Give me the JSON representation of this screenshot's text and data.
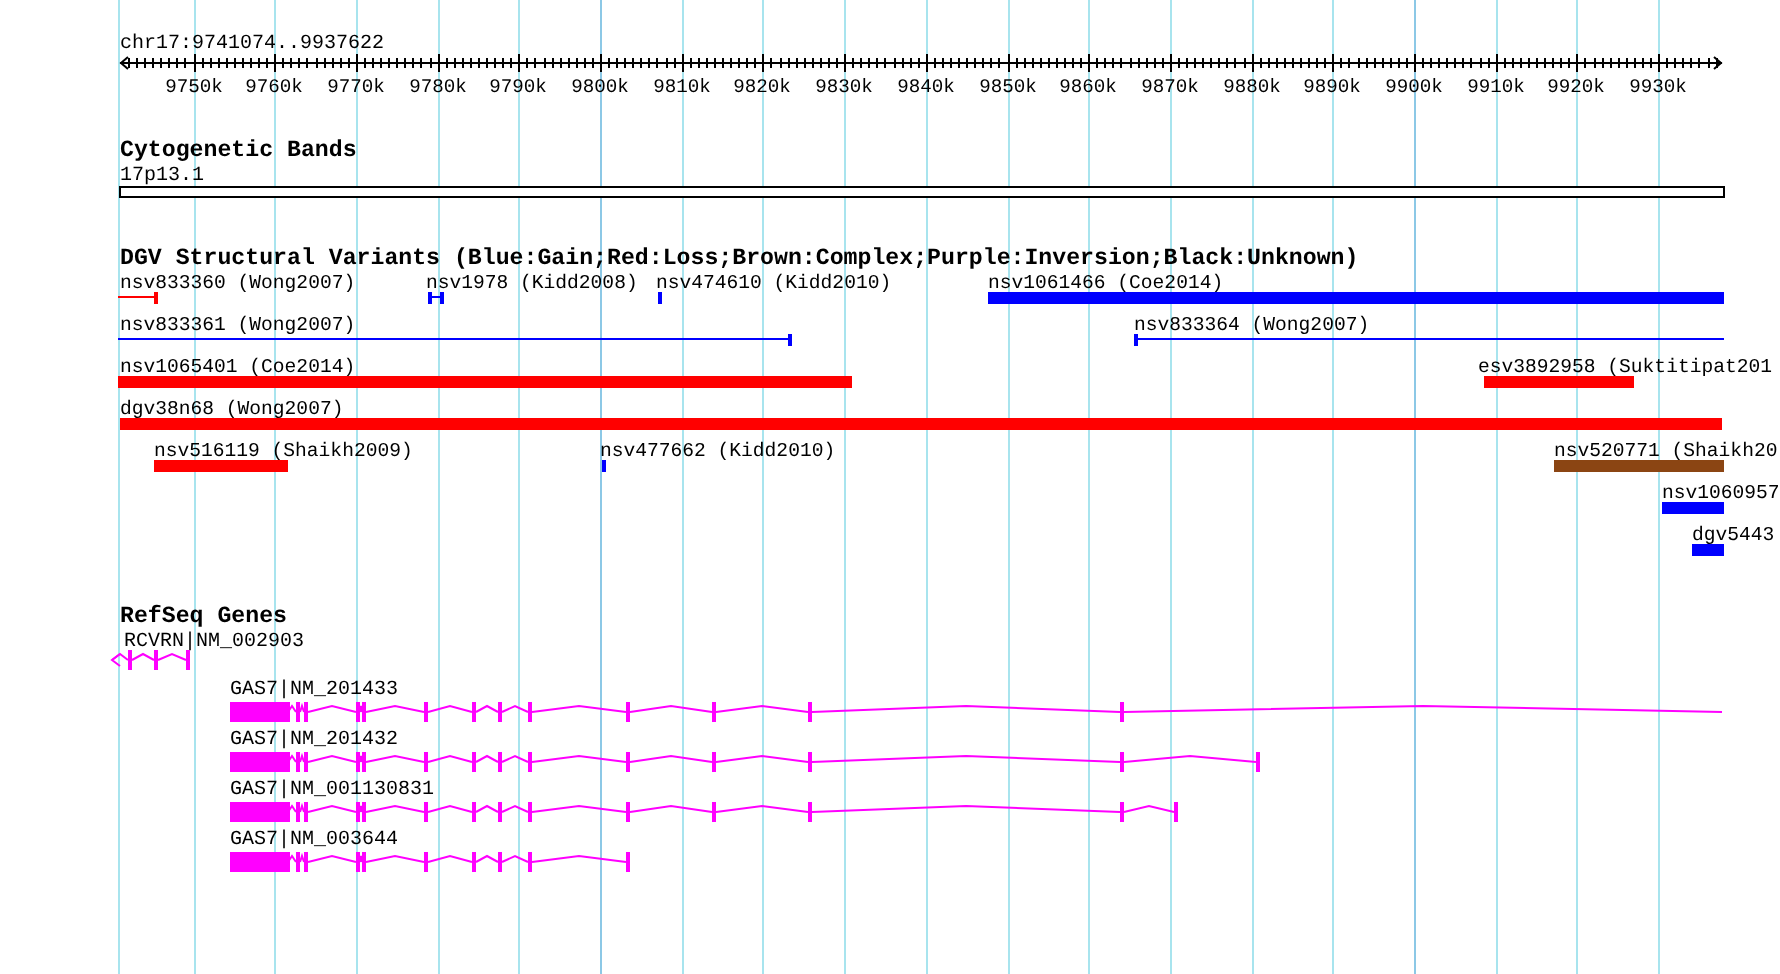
{
  "ruler": {
    "location": "chr17:9741074..9937622",
    "ticks": [
      "9750k",
      "9760k",
      "9770k",
      "9780k",
      "9790k",
      "9800k",
      "9810k",
      "9820k",
      "9830k",
      "9840k",
      "9850k",
      "9860k",
      "9870k",
      "9880k",
      "9890k",
      "9900k",
      "9910k",
      "9920k",
      "9930k"
    ]
  },
  "cytogenetic_bands": {
    "title": "Cytogenetic Bands",
    "band": "17p13.1"
  },
  "dgv_variants": {
    "title": "DGV Structural Variants (Blue:Gain;Red:Loss;Brown:Complex;Purple:Inversion;Black:Unknown)",
    "variants": [
      {
        "label": "nsv833360 (Wong2007)",
        "kind": "line",
        "color": "#ff0000"
      },
      {
        "label": "nsv1978 (Kidd2008)",
        "kind": "line",
        "color": "#0000ff"
      },
      {
        "label": "nsv474610 (Kidd2010)",
        "kind": "line",
        "color": "#0000ff"
      },
      {
        "label": "nsv1061466 (Coe2014)",
        "kind": "bar",
        "color": "#0000ff"
      },
      {
        "label": "nsv833361 (Wong2007)",
        "kind": "line",
        "color": "#0000ff"
      },
      {
        "label": "nsv833364 (Wong2007)",
        "kind": "line",
        "color": "#0000ff"
      },
      {
        "label": "nsv1065401 (Coe2014)",
        "kind": "bar",
        "color": "#ff0000"
      },
      {
        "label": "esv3892958 (Suktitipat201",
        "kind": "bar",
        "color": "#ff0000"
      },
      {
        "label": "dgv38n68 (Wong2007)",
        "kind": "bar",
        "color": "#ff0000"
      },
      {
        "label": "nsv516119 (Shaikh2009)",
        "kind": "bar",
        "color": "#ff0000"
      },
      {
        "label": "nsv477662 (Kidd2010)",
        "kind": "line",
        "color": "#0000ff"
      },
      {
        "label": "nsv520771 (Shaikh20",
        "kind": "bar",
        "color": "#8b4513"
      },
      {
        "label": "nsv1060957",
        "kind": "bar",
        "color": "#0000ff"
      },
      {
        "label": "dgv5443",
        "kind": "bar",
        "color": "#0000ff"
      }
    ]
  },
  "refseq_genes": {
    "title": "RefSeq Genes",
    "genes": [
      {
        "label": "RCVRN|NM_002903"
      },
      {
        "label": "GAS7|NM_201433"
      },
      {
        "label": "GAS7|NM_201432"
      },
      {
        "label": "GAS7|NM_001130831"
      },
      {
        "label": "GAS7|NM_003644"
      }
    ]
  }
}
